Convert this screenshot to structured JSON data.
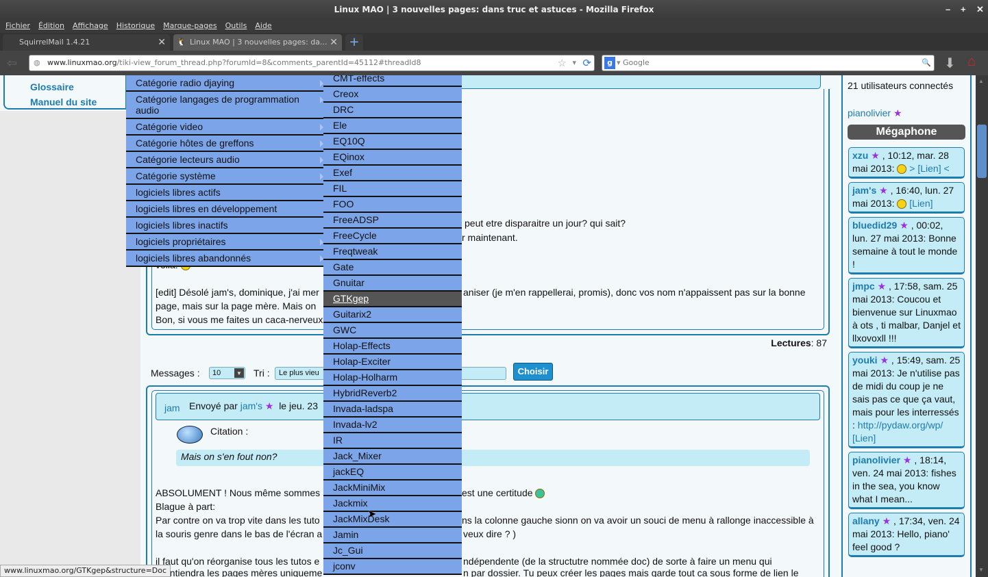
{
  "window": {
    "title": "Linux MAO | 3 nouvelles pages: dans truc et astuces - Mozilla Firefox",
    "controls": [
      "–",
      "+",
      "✕"
    ]
  },
  "menubar": [
    "Fichier",
    "Édition",
    "Affichage",
    "Historique",
    "Marque-pages",
    "Outils",
    "Aide"
  ],
  "tabs": [
    {
      "label": "SquirrelMail 1.4.21"
    },
    {
      "label": "Linux MAO | 3 nouvelles pages: da..."
    }
  ],
  "url": {
    "domain": "www.linuxmao.org",
    "path": "/tiki-view_forum_thread.php?forumId=8&comments_parentId=45112#threadId8"
  },
  "search": {
    "placeholder": "Google"
  },
  "left_nav": [
    {
      "label": "Glossaire"
    },
    {
      "label": "Manuel du site"
    }
  ],
  "menu1": [
    {
      "label": "Catégorie radio djaying",
      "sub": true
    },
    {
      "label": "Catégorie langages de programmation audio",
      "sub": true
    },
    {
      "label": "Catégorie video",
      "sub": true
    },
    {
      "label": "Catégorie hôtes de greffons",
      "sub": true
    },
    {
      "label": "Catégorie lecteurs audio",
      "sub": true
    },
    {
      "label": "Catégorie système",
      "sub": true
    },
    {
      "label": "logiciels libres actifs",
      "sub": false
    },
    {
      "label": "logiciels libres en développement",
      "sub": false
    },
    {
      "label": "logiciels libres inactifs",
      "sub": false
    },
    {
      "label": "logiciels propriétaires",
      "sub": true
    },
    {
      "label": "logiciels libres abandonnés",
      "sub": true
    }
  ],
  "menu2": [
    "CMT-effects",
    "Creox",
    "DRC",
    "Ele",
    "EQ10Q",
    "EQinox",
    "Exef",
    "FIL",
    "FOO",
    "FreeADSP",
    "FreeCycle",
    "Freqtweak",
    "Gate",
    "Gnuitar",
    "GTKgep",
    "Guitarix2",
    "GWC",
    "Holap-Effects",
    "Holap-Exciter",
    "Holap-Holharm",
    "HybridReverb2",
    "Invada-ladspa",
    "Invada-lv2",
    "IR",
    "Jack_Mixer",
    "jackEQ",
    "JackMiniMix",
    "Jackmix",
    "JackMixDesk",
    "Jamin",
    "Jc_Gui",
    "jconv"
  ],
  "menu2_selected": "GTKgep",
  "post1": {
    "l1": "peut etre disparaitre un jour? qui sait?",
    "l2": "r maintenant.",
    "l3": "voila!",
    "l4a": "[edit] Désolé jam's, dominique, j'ai mer",
    "l4b": "aniser (je m'en rappellerai, promis), donc vos nom n'appaissent pas sur la bonne",
    "l5": "page, mais sur la page mère. Mais on",
    "l6": "Bon, si vous me faites un caca-nerveux"
  },
  "reads": {
    "label": "Lectures",
    "value": ": 87"
  },
  "controls": {
    "messages_label": "Messages :",
    "messages_value": "10",
    "sort_label": "Tri :",
    "sort_value": "Le plus vieu",
    "choose": "Choisir"
  },
  "post2": {
    "user": "jam",
    "sent_by": "Envoyé par",
    "author": "jam's",
    "date": "le jeu. 23",
    "citation": "Citation :",
    "quote": "Mais on s'en fout non?",
    "l1a": "ABSOLUMENT ! Nous même sommes",
    "l1b": "est une certitude",
    "l2": "Blague à part:",
    "l3a": "Par contre on va trop vite dans les tuto",
    "l3b": "ns la colonne gauche sionn on va avoir un souci de menu à rallonge inaccessible à",
    "l4a": "la souris genre dans le bas de l'écran a",
    "l4b": "veux dire ? )",
    "l5a": "il faut qu'on réorganise tous les tutos e",
    "l5b": "ndépendente (de la structutre nommée doc) de sorte à faire un menu qui",
    "l6a": "ontiendra les pages mères uniqueme",
    "l6b": "n par dossier. Tu peux créer les pages mais garde tout ca sous forme de lien le"
  },
  "sidebar": {
    "connected": "21 utilisateurs connectés",
    "user": "pianolivier",
    "megaphone": "Mégaphone",
    "messages": [
      {
        "user": "xzu",
        "text": ", 10:12, mar. 28 mai 2013:",
        "tail": "> [Lien] <"
      },
      {
        "user": "jam's",
        "text": ", 16:40, lun. 27 mai 2013:",
        "tail": "[Lien]"
      },
      {
        "user": "bluedid29",
        "text": ", 00:02, lun. 27 mai 2013: Bonne semaine à tout le monde !",
        "tail": ""
      },
      {
        "user": "jmpc",
        "text": ", 17:58, sam. 25 mai 2013: Coucou et bienvenue sur Linuxmao à ots , ti malbar, Danjel et llxovoxll !!!",
        "tail": ""
      },
      {
        "user": "youki",
        "text": ", 15:49, sam. 25 mai 2013: Je n'utilise pas de midi du coup je ne sais pas ce que ça vaut, mais pour les interressés :",
        "link": "http://pydaw.org/wp/",
        "tail": "[Lien]"
      },
      {
        "user": "pianolivier",
        "text": ", 18:14, ven. 24 mai 2013: fishes in the sea, you know what I mean...",
        "tail": ""
      },
      {
        "user": "allany",
        "text": ", 17:34, ven. 24 mai 2013: Hello, piano' feel good ?",
        "tail": ""
      }
    ]
  },
  "statusbar": "www.linuxmao.org/GTKgep&structure=Doc"
}
